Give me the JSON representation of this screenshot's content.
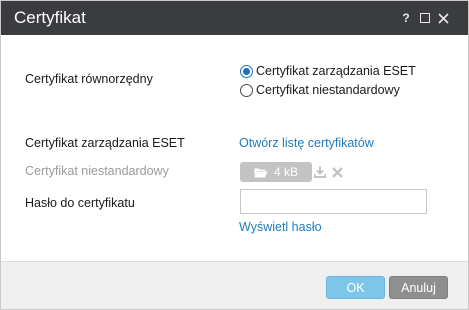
{
  "dialog": {
    "title": "Certyfikat",
    "help_icon": "question-mark-icon",
    "maximize_icon": "maximize-icon",
    "close_icon": "close-icon"
  },
  "form": {
    "peer_cert_label": "Certyfikat równorzędny",
    "radio_options": [
      {
        "label": "Certyfikat zarządzania ESET",
        "checked": true
      },
      {
        "label": "Certyfikat niestandardowy",
        "checked": false
      }
    ],
    "mgmt_cert_label": "Certyfikat zarządzania ESET",
    "open_list_link": "Otwórz listę certyfikatów",
    "custom_cert_label": "Certyfikat niestandardowy",
    "file_size": "4 kB",
    "password_label": "Hasło do certyfikatu",
    "password_value": "",
    "show_password_link": "Wyświetl hasło"
  },
  "footer": {
    "ok_label": "OK",
    "cancel_label": "Anuluj"
  },
  "colors": {
    "titlebar": "#3a3c3f",
    "link": "#1f7dbb",
    "ok_button": "#7ec5ea",
    "cancel_button": "#8f8f8f",
    "disabled_text": "#9b9b9b"
  }
}
